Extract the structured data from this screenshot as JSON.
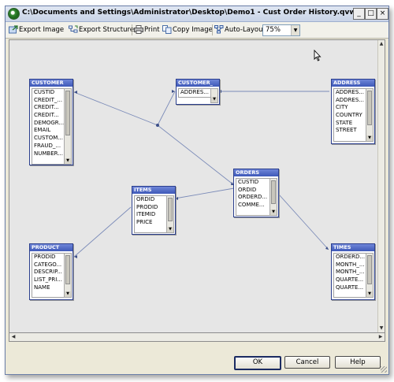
{
  "window": {
    "title": "C:\\Documents and Settings\\Administrator\\Desktop\\Demo1 - Cust Order History.qvw",
    "minimize_glyph": "_",
    "maximize_glyph": "□",
    "close_glyph": "×"
  },
  "toolbar": {
    "export_image": "Export Image",
    "export_structure": "Export Structure",
    "print": "Print",
    "copy_image": "Copy Image",
    "auto_layout": "Auto-Layout",
    "zoom_value": "75%"
  },
  "tables": {
    "customer": {
      "name": "CUSTOMER",
      "fields": [
        "CUSTID",
        "CREDIT_...",
        "CREDIT...",
        "CREDIT...",
        "DEMOGR...",
        "EMAIL",
        "CUSTOM...",
        "FRAUD_...",
        "NUMBER..."
      ]
    },
    "customer2": {
      "name": "CUSTOMER_",
      "fields": [
        "ADDRES..."
      ]
    },
    "address": {
      "name": "ADDRESS",
      "fields": [
        "ADDRES...",
        "ADDRES...",
        "CITY",
        "COUNTRY",
        "STATE",
        "STREET"
      ]
    },
    "orders": {
      "name": "ORDERS",
      "fields": [
        "CUSTID",
        "ORDID",
        "ORDERD...",
        "COMME..."
      ]
    },
    "items": {
      "name": "ITEMS",
      "fields": [
        "ORDID",
        "PRODID",
        "ITEMID",
        "PRICE"
      ]
    },
    "product": {
      "name": "PRODUCT",
      "fields": [
        "PRODID",
        "CATEGO...",
        "DESCRIP...",
        "LIST_PRI...",
        "NAME"
      ]
    },
    "times": {
      "name": "TIMES",
      "fields": [
        "ORDERD...",
        "MONTH_...",
        "MONTH_...",
        "QUARTE...",
        "QUARTE..."
      ]
    }
  },
  "buttons": {
    "ok": "OK",
    "cancel": "Cancel",
    "help": "Help"
  },
  "colors": {
    "table_header": "#3e59b8",
    "link_line": "#7b8bb8"
  }
}
